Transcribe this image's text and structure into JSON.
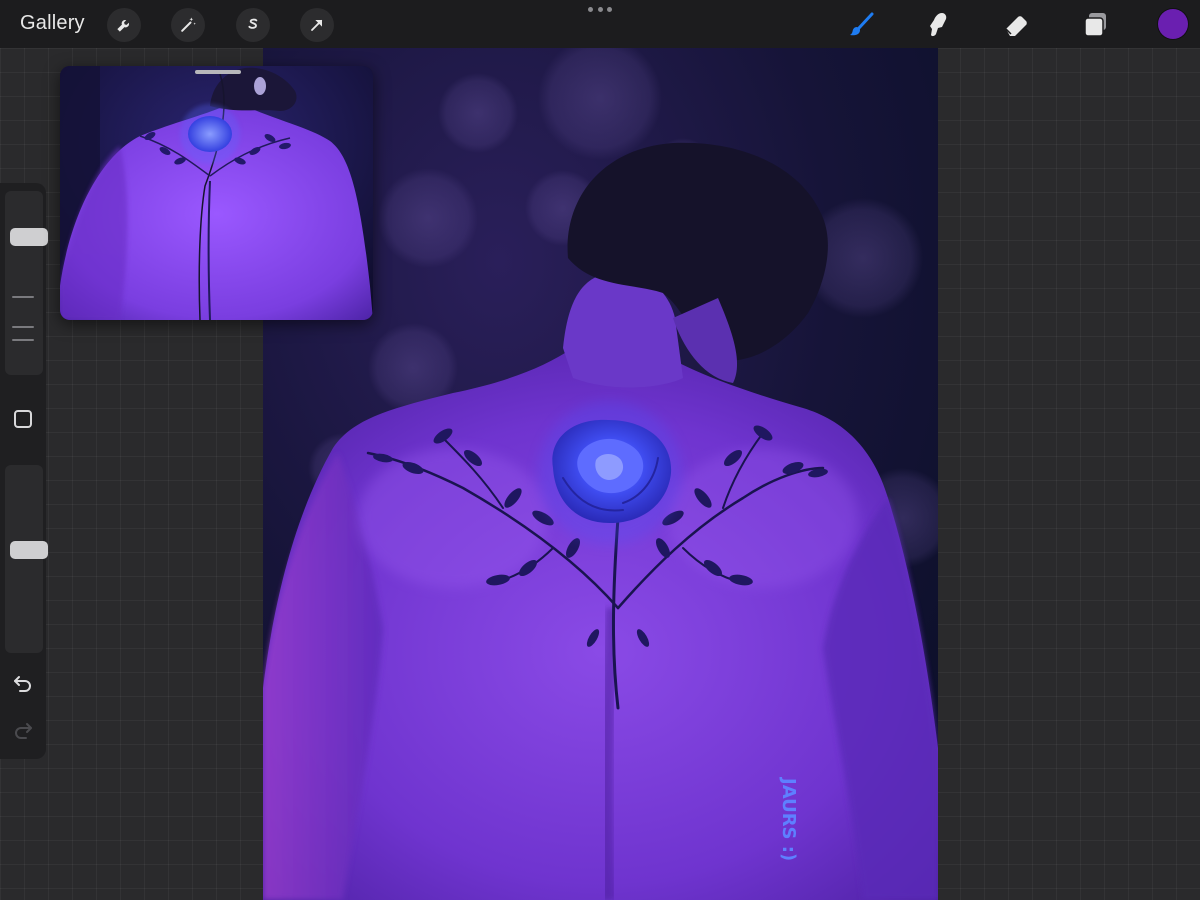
{
  "toolbar": {
    "gallery_label": "Gallery",
    "left_tools": [
      "wrench-icon",
      "magic-wand-icon",
      "selection-s-icon",
      "transform-arrow-icon"
    ],
    "right_tools": [
      "brush-icon",
      "smudge-icon",
      "eraser-icon",
      "layers-icon"
    ],
    "active_tool": "brush",
    "active_tool_color": "#1e7cf2",
    "current_color": "#6a1fb0"
  },
  "sidebar": {
    "size_slider_level": 0.78,
    "opacity_slider_level": 0.55,
    "buttons": [
      "modify-square-icon",
      "undo-icon",
      "redo-icon"
    ]
  },
  "canvas": {
    "signature": "JAURS :)",
    "palette": {
      "background_deep": "#0b1030",
      "background_purple": "#3a1f6e",
      "skin_purple": "#7a3ed6",
      "rose_blue": "#3f4cf0",
      "hair": "#15122a"
    }
  }
}
